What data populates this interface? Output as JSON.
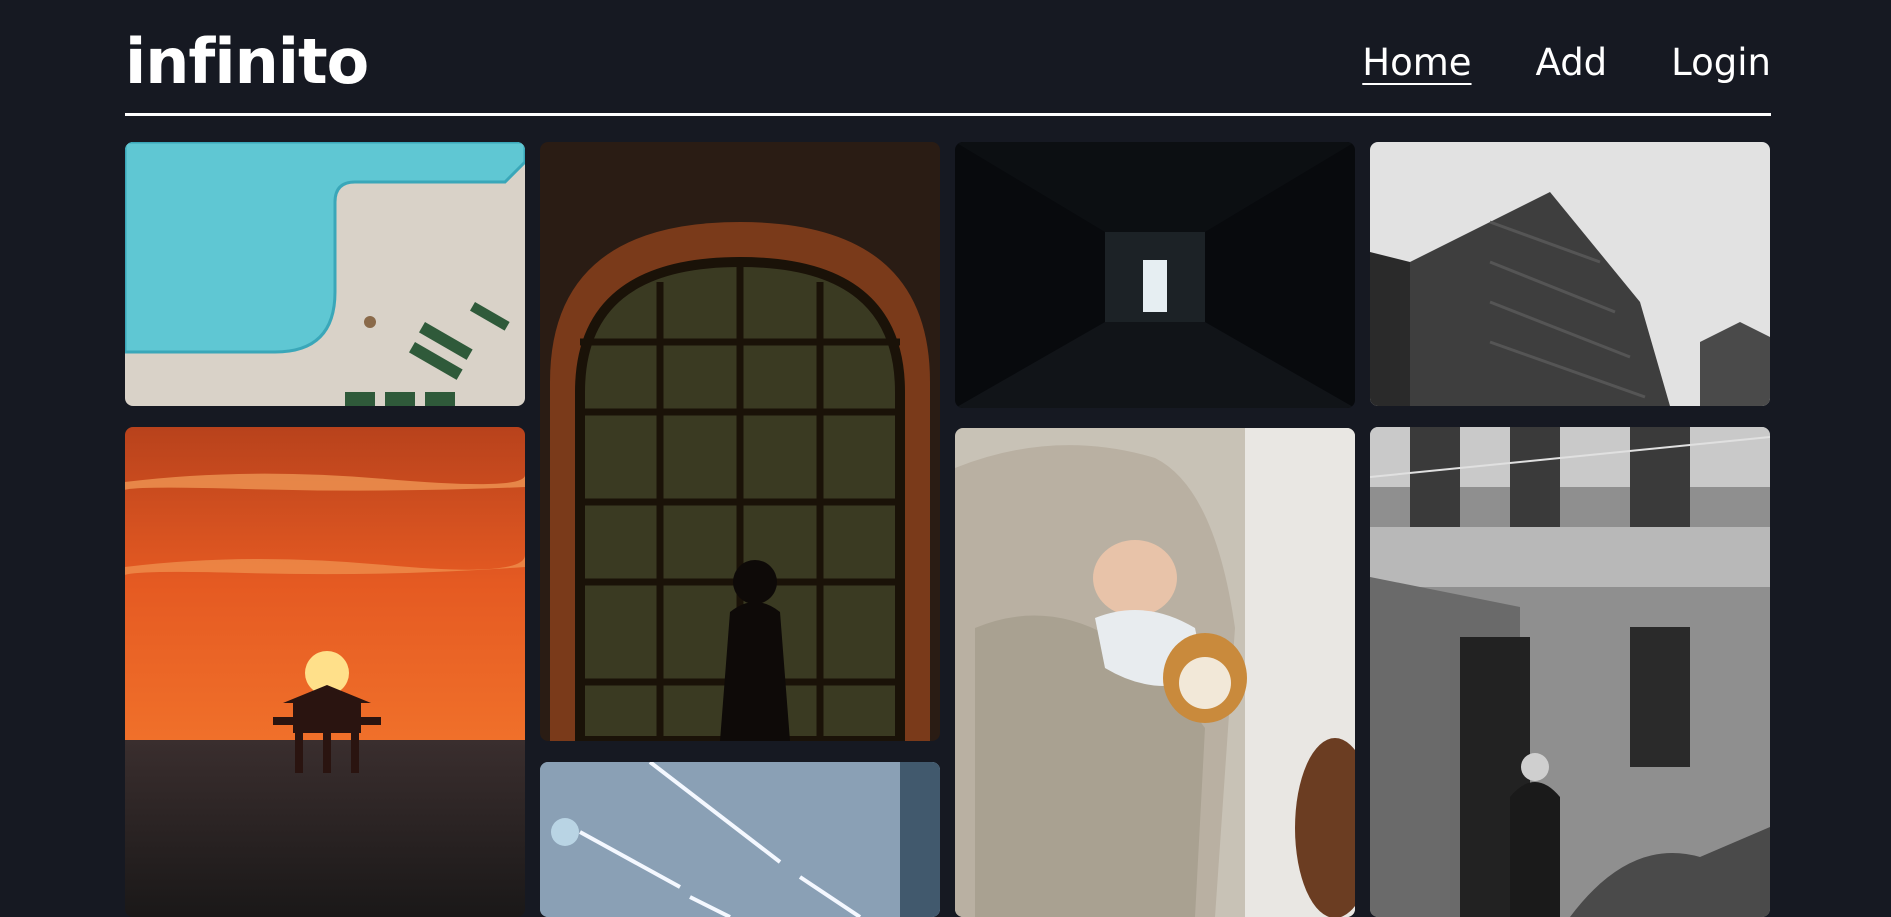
{
  "brand": {
    "name": "infinito"
  },
  "nav": {
    "items": [
      {
        "label": "Home",
        "active": true
      },
      {
        "label": "Add",
        "active": false
      },
      {
        "label": "Login",
        "active": false
      }
    ]
  },
  "colors": {
    "background": "#161922",
    "text": "#ffffff"
  }
}
